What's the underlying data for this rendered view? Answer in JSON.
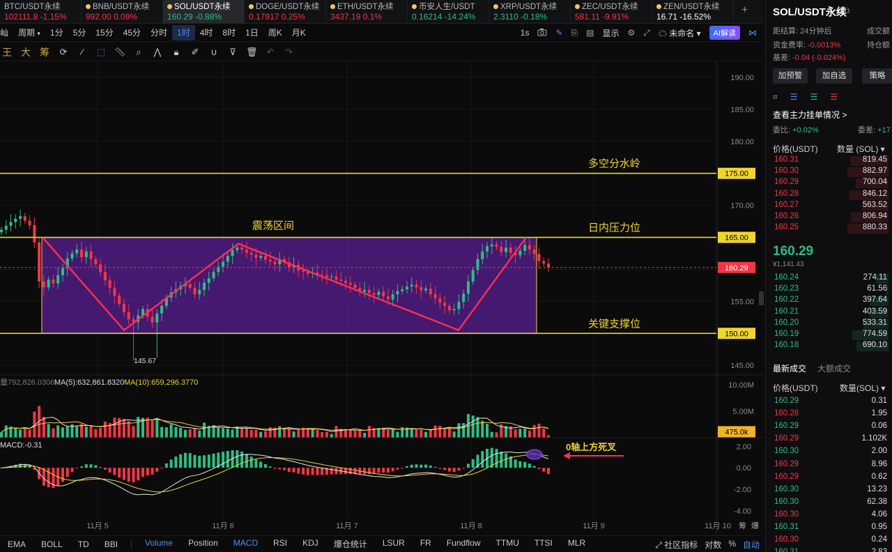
{
  "tickers": [
    {
      "symbol": "BTC/USDT永续",
      "price": "102111.8",
      "change": "-1.15%",
      "dir": "down"
    },
    {
      "symbol": "BNB/USDT永续",
      "price": "992.00",
      "change": "0.09%",
      "dir": "down"
    },
    {
      "symbol": "SOL/USDT永续",
      "price": "160.29",
      "change": "-0.88%",
      "dir": "up",
      "active": true
    },
    {
      "symbol": "DOGE/USDT永续",
      "price": "0.17917",
      "change": "0.25%",
      "dir": "down"
    },
    {
      "symbol": "ETH/USDT永续",
      "price": "3437.19",
      "change": "0.1%",
      "dir": "down"
    },
    {
      "symbol": "币安人生/USDT",
      "price": "0.16214",
      "change": "-14.24%",
      "dir": "up"
    },
    {
      "symbol": "XRP/USDT永续",
      "price": "2.3110",
      "change": "-0.18%",
      "dir": "up"
    },
    {
      "symbol": "ZEC/USDT永续",
      "price": "581.11",
      "change": "-9.91%",
      "dir": "down"
    },
    {
      "symbol": "ZEN/USDT永续",
      "price": "16.71",
      "change": "-16.52%",
      "dir": "plain"
    }
  ],
  "toolbar": {
    "left_label": "屾",
    "period_label": "周期",
    "timeframes": [
      "1分",
      "5分",
      "15分",
      "45分",
      "分时",
      "1时",
      "4时",
      "8时",
      "1日",
      "周K",
      "月K"
    ],
    "active_timeframe": "1时",
    "interval_text": "1s",
    "display_label": "显示",
    "account_label": "未命名",
    "ai_label": "AI解读"
  },
  "draw_tools": {
    "t1": "王",
    "t2": "大",
    "t3": "筹"
  },
  "chart_data": {
    "type": "candlestick",
    "symbol": "SOL/USDT永续",
    "interval": "1时",
    "price_axis": {
      "ticks": [
        190,
        185,
        180,
        175,
        170,
        165,
        160,
        155,
        150,
        145
      ],
      "labels": [
        "190.00",
        "185.00",
        "180.00",
        "175.00",
        "170.00",
        "165.00",
        "155.00",
        "150.00",
        "145.00"
      ],
      "range": [
        143.5,
        192.5
      ]
    },
    "x_axis": {
      "labels": [
        "11月 5",
        "11月 6",
        "11月 7",
        "11月 8",
        "11月 9",
        "11月 10"
      ]
    },
    "candles_close": [
      166.2,
      166.8,
      167.4,
      167.9,
      168.3,
      167.6,
      166.9,
      164.2,
      158.1,
      157.2,
      158.4,
      157.8,
      159.1,
      160.2,
      161.7,
      162.5,
      163.1,
      161.9,
      162.8,
      161.6,
      160.8,
      159.6,
      158.3,
      157.1,
      155.9,
      154.6,
      153.3,
      152.2,
      151.8,
      152.8,
      153.8,
      152.6,
      151.7,
      153.1,
      154.3,
      155.6,
      156.4,
      156.9,
      157.4,
      157.7,
      157.1,
      156.1,
      156.8,
      157.9,
      158.6,
      159.6,
      160.4,
      161.2,
      162.1,
      163.0,
      163.4,
      163.1,
      162.6,
      162.3,
      161.8,
      162.1,
      161.5,
      161.2,
      160.8,
      161.6,
      161.1,
      160.3,
      160.7,
      159.8,
      159.6,
      159.3,
      159.5,
      159.2,
      159.1,
      158.8,
      158.9,
      158.4,
      158.2,
      157.9,
      157.6,
      157.1,
      156.5,
      156.8,
      156.3,
      156.0,
      156.5,
      155.8,
      155.3,
      156.1,
      156.6,
      156.9,
      157.3,
      157.6,
      157.2,
      156.7,
      157.0,
      156.1,
      155.5,
      154.8,
      154.3,
      153.6,
      153.8,
      154.9,
      156.2,
      158.1,
      159.9,
      161.6,
      162.8,
      163.6,
      163.9,
      163.5,
      162.7,
      163.4,
      162.6,
      162.2,
      162.9,
      163.8,
      163.1,
      162.4,
      161.3,
      160.9,
      160.3
    ],
    "candles_open": [
      165.8,
      166.2,
      166.8,
      167.4,
      167.9,
      168.3,
      167.6,
      166.9,
      164.2,
      158.1,
      157.2,
      158.4,
      157.8,
      159.1,
      160.2,
      161.7,
      162.5,
      163.1,
      161.9,
      162.8,
      161.6,
      160.8,
      159.6,
      158.3,
      157.1,
      155.9,
      154.6,
      153.3,
      152.2,
      151.8,
      152.8,
      153.8,
      152.6,
      151.7,
      153.1,
      154.3,
      155.6,
      156.4,
      156.9,
      157.4,
      157.7,
      157.1,
      156.1,
      156.8,
      157.9,
      158.6,
      159.6,
      160.4,
      161.2,
      162.1,
      163.0,
      163.4,
      163.1,
      162.6,
      162.3,
      161.8,
      162.1,
      161.5,
      161.2,
      160.8,
      161.6,
      161.1,
      160.3,
      160.7,
      159.8,
      159.6,
      159.3,
      159.5,
      159.2,
      159.1,
      158.8,
      158.9,
      158.4,
      158.2,
      157.9,
      157.6,
      157.1,
      156.5,
      156.8,
      156.3,
      156.0,
      156.5,
      155.8,
      155.3,
      156.1,
      156.6,
      156.9,
      157.3,
      157.6,
      157.2,
      156.7,
      157.0,
      156.1,
      155.5,
      154.8,
      154.3,
      153.6,
      153.8,
      154.9,
      156.2,
      158.1,
      159.9,
      161.6,
      162.8,
      163.6,
      163.9,
      163.5,
      162.7,
      163.4,
      162.6,
      162.2,
      162.9,
      163.8,
      163.1,
      162.4,
      161.3,
      160.9
    ],
    "low_wick_marker": {
      "value": 145.67,
      "label": "145.67"
    },
    "levels": [
      {
        "value": 175.0,
        "label": "175.00",
        "annotation": "多空分水岭"
      },
      {
        "value": 165.0,
        "label": "165.00",
        "annotation": "日内压力位"
      },
      {
        "value": 150.0,
        "label": "150.00",
        "annotation": "关键支撑位"
      }
    ],
    "range_box": {
      "top": 165.0,
      "bottom": 150.0,
      "label": "震荡区间"
    },
    "zigzag_prices": [
      165.0,
      150.5,
      164.0,
      150.5,
      165.0
    ],
    "current_price": {
      "value": 160.29,
      "label": "160.29"
    },
    "volume": {
      "header_prefix": "量792,826.0306",
      "ma5_text": "MA(5):632,861.8320",
      "ma10_text": "MA(10):659,296.3770",
      "axis_labels": [
        "10.00M",
        "5.00M"
      ],
      "current_label": "475.0k",
      "max": 10.8
    },
    "macd": {
      "header_text": "MACD:-0.31",
      "axis_labels": [
        "2.00",
        "0.00",
        "-2.00",
        "-4.00"
      ],
      "range": [
        -4.6,
        2.8
      ],
      "annotation": "0轴上方死叉"
    },
    "panel_labels": {
      "top": "筹",
      "right": "爆"
    }
  },
  "indicators": {
    "left": [
      "EMA",
      "BOLL",
      "TD",
      "BBI"
    ],
    "right": [
      "Volume",
      "Position",
      "MACD",
      "RSI",
      "KDJ",
      "爆仓统计",
      "LSUR",
      "FR",
      "Fundflow",
      "TTMU",
      "TTSI",
      "MLR"
    ],
    "active": [
      "Volume",
      "MACD"
    ],
    "community": "社区指标",
    "log_label": "对数",
    "pct_label": "%",
    "auto_label": "自动"
  },
  "panel": {
    "title": "SOL/USDT永续",
    "settle_label": "距结算",
    "settle_value": "24分钟后",
    "funding_label": "资金费率:",
    "funding_value": "-0.0013%",
    "basis_label": "基差:",
    "basis_value": "-0.04 (-0.024%)",
    "right_info1": "成交额",
    "right_info2": "持仓额",
    "buttons": [
      "加预警",
      "加自选",
      "策略"
    ],
    "main_order_label": "查看主力挂单情况 >",
    "ratio_label": "委比:",
    "ratio_value": "+0.02%",
    "diff_label": "委差:",
    "diff_value": "+17",
    "col_price": "价格(USDT)",
    "col_qty": "数量 (SOL)",
    "asks": [
      {
        "p": "160.31",
        "q": "819.45"
      },
      {
        "p": "160.30",
        "q": "882.97"
      },
      {
        "p": "160.29",
        "q": "700.04"
      },
      {
        "p": "160.28",
        "q": "846.12"
      },
      {
        "p": "160.27",
        "q": "563.52"
      },
      {
        "p": "160.26",
        "q": "806.94"
      },
      {
        "p": "160.25",
        "q": "880.33"
      }
    ],
    "last_price": "160.29",
    "last_sub": "¥1,141.43",
    "bids": [
      {
        "p": "160.24",
        "q": "274.11"
      },
      {
        "p": "160.23",
        "q": "61.56"
      },
      {
        "p": "160.22",
        "q": "397.64"
      },
      {
        "p": "160.21",
        "q": "403.59"
      },
      {
        "p": "160.20",
        "q": "533.31"
      },
      {
        "p": "160.19",
        "q": "774.59"
      },
      {
        "p": "160.18",
        "q": "690.10"
      }
    ],
    "tab_latest": "最新成交",
    "tab_large": "大额成交",
    "trade_col_price": "价格(USDT)",
    "trade_col_qty": "数量(SOL)",
    "trades": [
      {
        "p": "160.29",
        "q": "0.31",
        "s": "g"
      },
      {
        "p": "160.28",
        "q": "1.95",
        "s": "r"
      },
      {
        "p": "160.29",
        "q": "0.06",
        "s": "g"
      },
      {
        "p": "160.29",
        "q": "1.102K",
        "s": "r"
      },
      {
        "p": "160.30",
        "q": "2.00",
        "s": "g"
      },
      {
        "p": "160.29",
        "q": "8.96",
        "s": "r"
      },
      {
        "p": "160.29",
        "q": "0.62",
        "s": "r"
      },
      {
        "p": "160.30",
        "q": "13.23",
        "s": "g"
      },
      {
        "p": "160.30",
        "q": "62.38",
        "s": "g"
      },
      {
        "p": "160.30",
        "q": "4.06",
        "s": "r"
      },
      {
        "p": "160.31",
        "q": "0.95",
        "s": "g"
      },
      {
        "p": "160.30",
        "q": "0.24",
        "s": "r"
      },
      {
        "p": "160.31",
        "q": "2.83",
        "s": "g"
      }
    ]
  },
  "colors": {
    "up": "#2ebd85",
    "down": "#f23645",
    "level": "#f0d532",
    "box": "#5a1f93",
    "zigzag": "#ff2f4f",
    "accent": "#4c8dff"
  }
}
